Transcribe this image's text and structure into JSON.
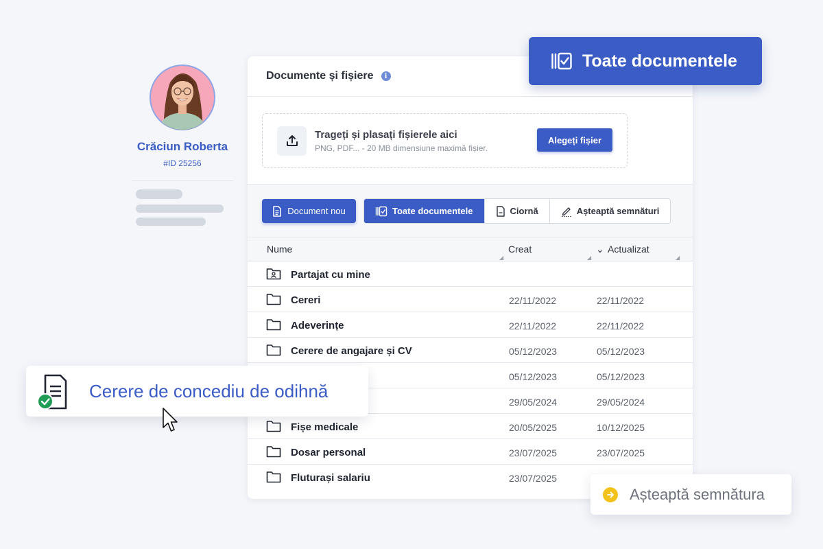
{
  "profile": {
    "name": "Crăciun Roberta",
    "id": "#ID 25256"
  },
  "card": {
    "title": "Documente și fișiere",
    "upload": {
      "title": "Trageți și plasați fișierele aici",
      "subtitle": "PNG, PDF... - 20 MB dimensiune maximă fișier.",
      "button": "Alegeți fișier"
    },
    "toolbar": {
      "new_document": "Document nou",
      "filters": [
        {
          "label": "Toate documentele",
          "icon": "all-docs-icon",
          "active": true
        },
        {
          "label": "Ciornă",
          "icon": "draft-icon",
          "active": false
        },
        {
          "label": "Așteaptă semnături",
          "icon": "pen-icon",
          "active": false
        }
      ]
    },
    "table": {
      "columns": {
        "name": "Nume",
        "created": "Creat",
        "updated": "Actualizat"
      },
      "rows": [
        {
          "name": "Partajat cu mine",
          "created": "",
          "updated": "",
          "icon": "shared-folder-icon"
        },
        {
          "name": "Cereri",
          "created": "22/11/2022",
          "updated": "22/11/2022",
          "icon": "folder-icon"
        },
        {
          "name": "Adeverințe",
          "created": "22/11/2022",
          "updated": "22/11/2022",
          "icon": "folder-icon"
        },
        {
          "name": "Cerere de angajare și CV",
          "created": "05/12/2023",
          "updated": "05/12/2023",
          "icon": "folder-icon"
        },
        {
          "name": "",
          "created": "05/12/2023",
          "updated": "05/12/2023",
          "icon": "folder-icon"
        },
        {
          "name": "",
          "created": "29/05/2024",
          "updated": "29/05/2024",
          "icon": "folder-icon"
        },
        {
          "name": "Fișe medicale",
          "created": "20/05/2025",
          "updated": "10/12/2025",
          "icon": "folder-icon"
        },
        {
          "name": "Dosar personal",
          "created": "23/07/2025",
          "updated": "23/07/2025",
          "icon": "folder-icon"
        },
        {
          "name": "Fluturași salariu",
          "created": "23/07/2025",
          "updated": "",
          "icon": "folder-icon"
        }
      ]
    }
  },
  "badge_all": {
    "label": "Toate documentele"
  },
  "float_doc": {
    "label": "Cerere de concediu de odihnă"
  },
  "float_sign": {
    "label": "Așteaptă semnătura"
  },
  "colors": {
    "accent": "#3b5cc4",
    "success": "#1f9d55",
    "warning": "#f3c21a",
    "background": "#f4f6fa"
  }
}
